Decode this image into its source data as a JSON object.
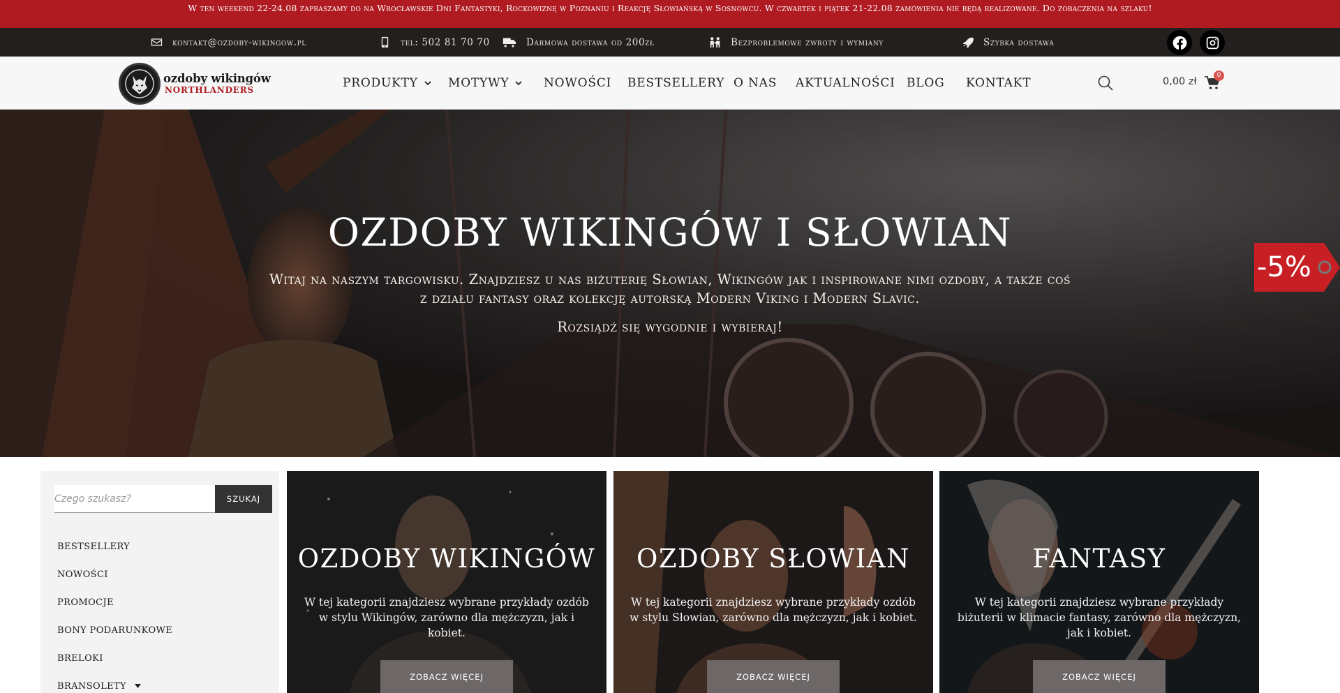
{
  "announcement": "W ten weekend 22-24.08 zapraszamy do na Wrocławskie Dni Fantastyki, Rockowiznę w Poznaniu i Reakcję Słowiańską w Sosnowcu. W czwartek i piątek 21-22.08 zamówienia nie będą realizowane. Do zobaczenia na szlaku!",
  "infobar": {
    "email": "kontakt@ozdoby-wikingow.pl",
    "phone": "tel: 502 81 70 70",
    "shipping": "Darmowa dostawa od 200zł",
    "returns": "Bezproblemowe zwroty i wymiany",
    "fast": "Szybka dostawa",
    "icons": {
      "email": "envelope-icon",
      "phone": "mobile-phone-icon",
      "shipping": "truck-icon",
      "returns": "people-exchange-icon",
      "fast": "rocket-icon",
      "facebook": "facebook-icon",
      "instagram": "instagram-icon"
    }
  },
  "logo": {
    "line1": "ozdoby wikingów",
    "line2": "NORTHLANDERS"
  },
  "nav": {
    "items": [
      {
        "label": "PRODUKTY",
        "dropdown": true
      },
      {
        "label": "MOTYWY",
        "dropdown": true
      },
      {
        "label": "NOWOŚCI",
        "dropdown": false
      },
      {
        "label": "BESTSELLERY",
        "dropdown": false
      },
      {
        "label": "O NAS",
        "dropdown": false
      },
      {
        "label": "AKTUALNOŚCI",
        "dropdown": false
      },
      {
        "label": "BLOG",
        "dropdown": false
      },
      {
        "label": "KONTAKT",
        "dropdown": false
      }
    ],
    "cart_total": "0,00 zł",
    "cart_count": "0"
  },
  "hero": {
    "title": "OZDOBY WIKINGÓW I SŁOWIAN",
    "subtitle": "Witaj na naszym targowisku. Znajdziesz u nas biżuterię Słowian, Wikingów jak i inspirowane nimi ozdoby, a także coś z działu fantasy oraz kolekcję autorską Modern Viking i Modern Slavic.",
    "subtitle2": "Rozsiądź się wygodnie i wybieraj!",
    "promo_label": "-5%"
  },
  "sidebar": {
    "search_placeholder": "Czego szukasz?",
    "search_button": "SZUKAJ",
    "items": [
      {
        "label": "BESTSELLERY",
        "expandable": false
      },
      {
        "label": "NOWOŚCI",
        "expandable": false
      },
      {
        "label": "PROMOCJE",
        "expandable": false
      },
      {
        "label": "BONY PODARUNKOWE",
        "expandable": false
      },
      {
        "label": "BRELOKI",
        "expandable": false
      },
      {
        "label": "BRANSOLETY",
        "expandable": true
      }
    ]
  },
  "cards": [
    {
      "title": "OZDOBY WIKINGÓW",
      "text": "W tej kategorii znajdziesz wybrane przykłady ozdób w stylu Wikingów, zarówno dla mężczyzn, jak i kobiet.",
      "button": "ZOBACZ WIĘCEJ"
    },
    {
      "title": "OZDOBY SŁOWIAN",
      "text": "W tej kategorii znajdziesz wybrane przykłady ozdób w stylu Słowian, zarówno dla mężczyzn, jak i kobiet.",
      "button": "ZOBACZ WIĘCEJ"
    },
    {
      "title": "FANTASY",
      "text": "W tej kategorii znajdziesz wybrane przykłady biżuterii w klimacie fantasy, zarówno dla mężczyzn, jak i kobiet.",
      "button": "ZOBACZ WIĘCEJ"
    }
  ],
  "colors": {
    "brand_red": "#b01b22",
    "topbar_dark": "#231f1e",
    "header_bg": "#f7f7f7",
    "button_grey": "#6d6867"
  }
}
